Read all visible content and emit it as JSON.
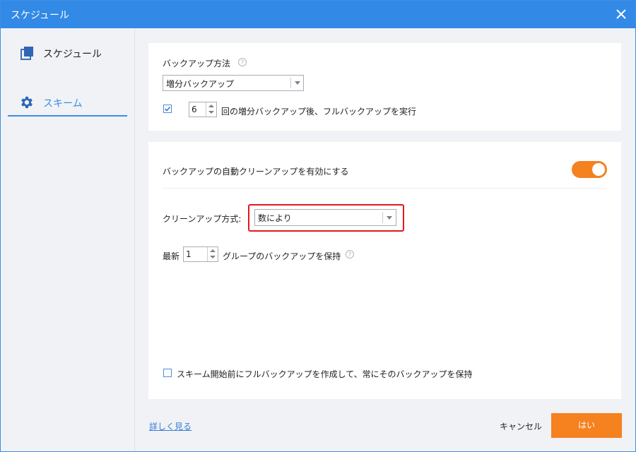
{
  "window": {
    "title": "スケジュール"
  },
  "sidebar": {
    "items": [
      {
        "label": "スケジュール",
        "icon": "copy-icon",
        "active": false
      },
      {
        "label": "スキーム",
        "icon": "gear-icon",
        "active": true
      }
    ]
  },
  "backup": {
    "method_label": "バックアップ方法",
    "method_value": "増分バックアップ",
    "full_after_count": "6",
    "full_after_label": "回の増分バックアップ後、フルバックアップを実行"
  },
  "cleanup": {
    "enable_label": "バックアップの自動クリーンアップを有効にする",
    "enabled": true,
    "method_label": "クリーンアップ方式:",
    "method_value": "数により",
    "latest_label": "最新",
    "latest_count": "1",
    "keep_label": "グループのバックアップを保持",
    "full_before_label": "スキーム開始前にフルバックアップを作成して、常にそのバックアップを保持"
  },
  "footer": {
    "details_link": "詳しく見る",
    "cancel_label": "キャンセル",
    "ok_label": "はい"
  },
  "colors": {
    "titlebar": "#3289e6",
    "accent": "#3a8ee6",
    "orange": "#f5811f",
    "highlight": "#e0191f"
  }
}
